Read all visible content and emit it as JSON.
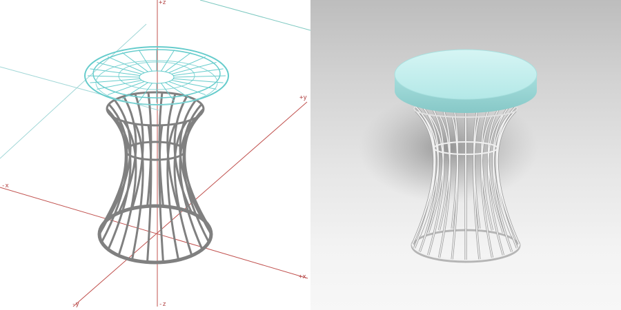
{
  "viewport_wireframe": {
    "axis_labels": {
      "pos_z": "+z",
      "pos_y": "+y",
      "neg_x": "-x",
      "pos_x": "+x",
      "neg_y": "-y",
      "neg_z": "-z"
    },
    "colors": {
      "axis": "#c0504d",
      "grid_line": "#9fd6d6",
      "seat_wire": "#66cccc",
      "frame_wire": "#808080"
    }
  },
  "viewport_render": {
    "colors": {
      "seat": "#bfeeed",
      "frame": "#d9d9d9",
      "shadow": "#8e8e8e"
    }
  }
}
